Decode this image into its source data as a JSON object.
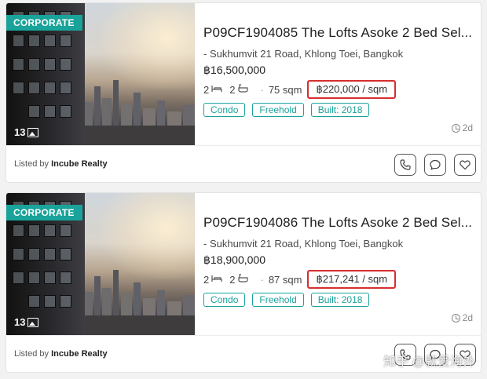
{
  "listings": [
    {
      "badge": "CORPORATE",
      "photo_count": "13",
      "title": "P09CF1904085 The Lofts Asoke 2 Bed Sel...",
      "address": "- Sukhumvit 21 Road, Khlong Toei, Bangkok",
      "price": "฿16,500,000",
      "beds": "2",
      "baths": "2",
      "area": "75 sqm",
      "price_per_sqm": "฿220,000 / sqm",
      "tags": [
        "Condo",
        "Freehold",
        "Built: 2018"
      ],
      "posted": "2d",
      "listed_by_prefix": "Listed by",
      "agency": "Incube Realty"
    },
    {
      "badge": "CORPORATE",
      "photo_count": "13",
      "title": "P09CF1904086 The Lofts Asoke 2 Bed Sel...",
      "address": "- Sukhumvit 21 Road, Khlong Toei, Bangkok",
      "price": "฿18,900,000",
      "beds": "2",
      "baths": "2",
      "area": "87 sqm",
      "price_per_sqm": "฿217,241 / sqm",
      "tags": [
        "Condo",
        "Freehold",
        "Built: 2018"
      ],
      "posted": "2d",
      "listed_by_prefix": "Listed by",
      "agency": "Incube Realty"
    }
  ],
  "icons": {
    "photos": "image-icon",
    "bed": "bed-icon",
    "bath": "bath-icon",
    "clock": "clock-icon",
    "call": "phone-icon",
    "chat": "chat-icon",
    "save": "heart-icon"
  },
  "colors": {
    "accent": "#19a39a",
    "highlight_box": "#d72e2e"
  },
  "watermark": "知乎 @就爱海外"
}
